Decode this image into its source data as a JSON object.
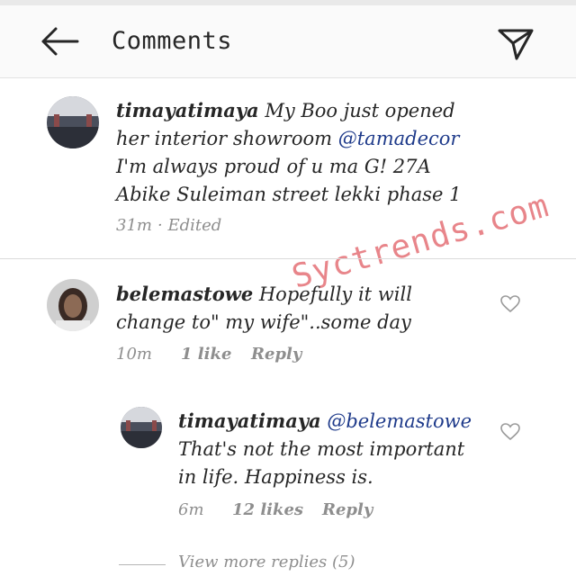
{
  "header": {
    "title": "Comments"
  },
  "comments": [
    {
      "username": "timayatimaya",
      "text_before": " My Boo just opened her interior showroom ",
      "mention": "@tamadecor",
      "text_after": "  I'm always proud of u ma G! 27A Abike Suleiman street lekki phase 1",
      "time": "31m",
      "edited": "· Edited"
    },
    {
      "username": "belemastowe",
      "text": " Hopefully it will change to\" my wife\"..some day",
      "time": "10m",
      "likes": "1 like",
      "reply_label": "Reply",
      "replies": [
        {
          "username": "timayatimaya",
          "mention": "@belemastowe",
          "text": "That's not the most important in life. Happiness is.",
          "time": "6m",
          "likes": "12 likes",
          "reply_label": "Reply"
        }
      ],
      "view_more": "View more replies (5)"
    }
  ],
  "watermark": "Syctrends.com",
  "colors": {
    "mention": "#1e3a8a",
    "meta": "#8e8e8e",
    "watermark": "#e8858a",
    "header_bg": "#fafafa"
  }
}
